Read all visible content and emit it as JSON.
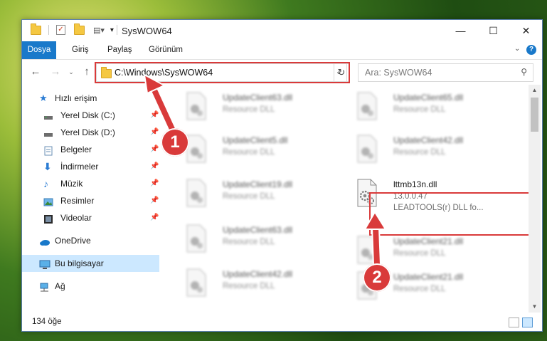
{
  "window": {
    "title": "SysWOW64",
    "controls": {
      "minimize": "—",
      "maximize": "☐",
      "close": "✕"
    }
  },
  "ribbon": {
    "tabs": [
      "Dosya",
      "Giriş",
      "Paylaş",
      "Görünüm"
    ],
    "help": "?"
  },
  "navigation": {
    "address_path": "C:\\Windows\\SysWOW64",
    "search_placeholder": "Ara: SysWOW64"
  },
  "sidebar": {
    "quick_access": "Hızlı erişim",
    "items": [
      {
        "label": "Yerel Disk (C:)",
        "icon": "drive-icon",
        "pinned": true
      },
      {
        "label": "Yerel Disk (D:)",
        "icon": "drive-icon",
        "pinned": true
      },
      {
        "label": "Belgeler",
        "icon": "documents-icon",
        "pinned": true
      },
      {
        "label": "İndirmeler",
        "icon": "download-icon",
        "pinned": true
      },
      {
        "label": "Müzik",
        "icon": "music-icon",
        "pinned": true
      },
      {
        "label": "Resimler",
        "icon": "pictures-icon",
        "pinned": true
      },
      {
        "label": "Videolar",
        "icon": "videos-icon",
        "pinned": true
      }
    ],
    "onedrive": "OneDrive",
    "this_pc": "Bu bilgisayar",
    "network": "Ağ"
  },
  "files": [
    {
      "name": "UpdateClient63.dll",
      "type": "Resource DLL",
      "blurred": true
    },
    {
      "name": "UpdateClient65.dll",
      "type": "Resource DLL",
      "blurred": true
    },
    {
      "name": "UpdateClient5.dll",
      "type": "Resource DLL",
      "blurred": true
    },
    {
      "name": "UpdateClient42.dll",
      "type": "Resource DLL",
      "blurred": true
    },
    {
      "name": "UpdateClient19.dll",
      "type": "Resource DLL",
      "blurred": true
    },
    {
      "name": "lttmb13n.dll",
      "version": "13.0.0.47",
      "type": "LEADTOOLS(r) DLL fo...",
      "blurred": false,
      "highlighted": true
    },
    {
      "name": "UpdateClient63.dll",
      "type": "Resource DLL",
      "blurred": true
    },
    {
      "name": "UpdateClient21.dll",
      "type": "Resource DLL",
      "blurred": true
    },
    {
      "name": "UpdateClient42.dll",
      "type": "Resource DLL",
      "blurred": true
    },
    {
      "name": "UpdateClient21.dll",
      "type": "Resource DLL",
      "blurred": true
    }
  ],
  "status": {
    "item_count": "134 öğe"
  },
  "annotations": {
    "step1": "1",
    "step2": "2",
    "color": "#d93a3a"
  }
}
